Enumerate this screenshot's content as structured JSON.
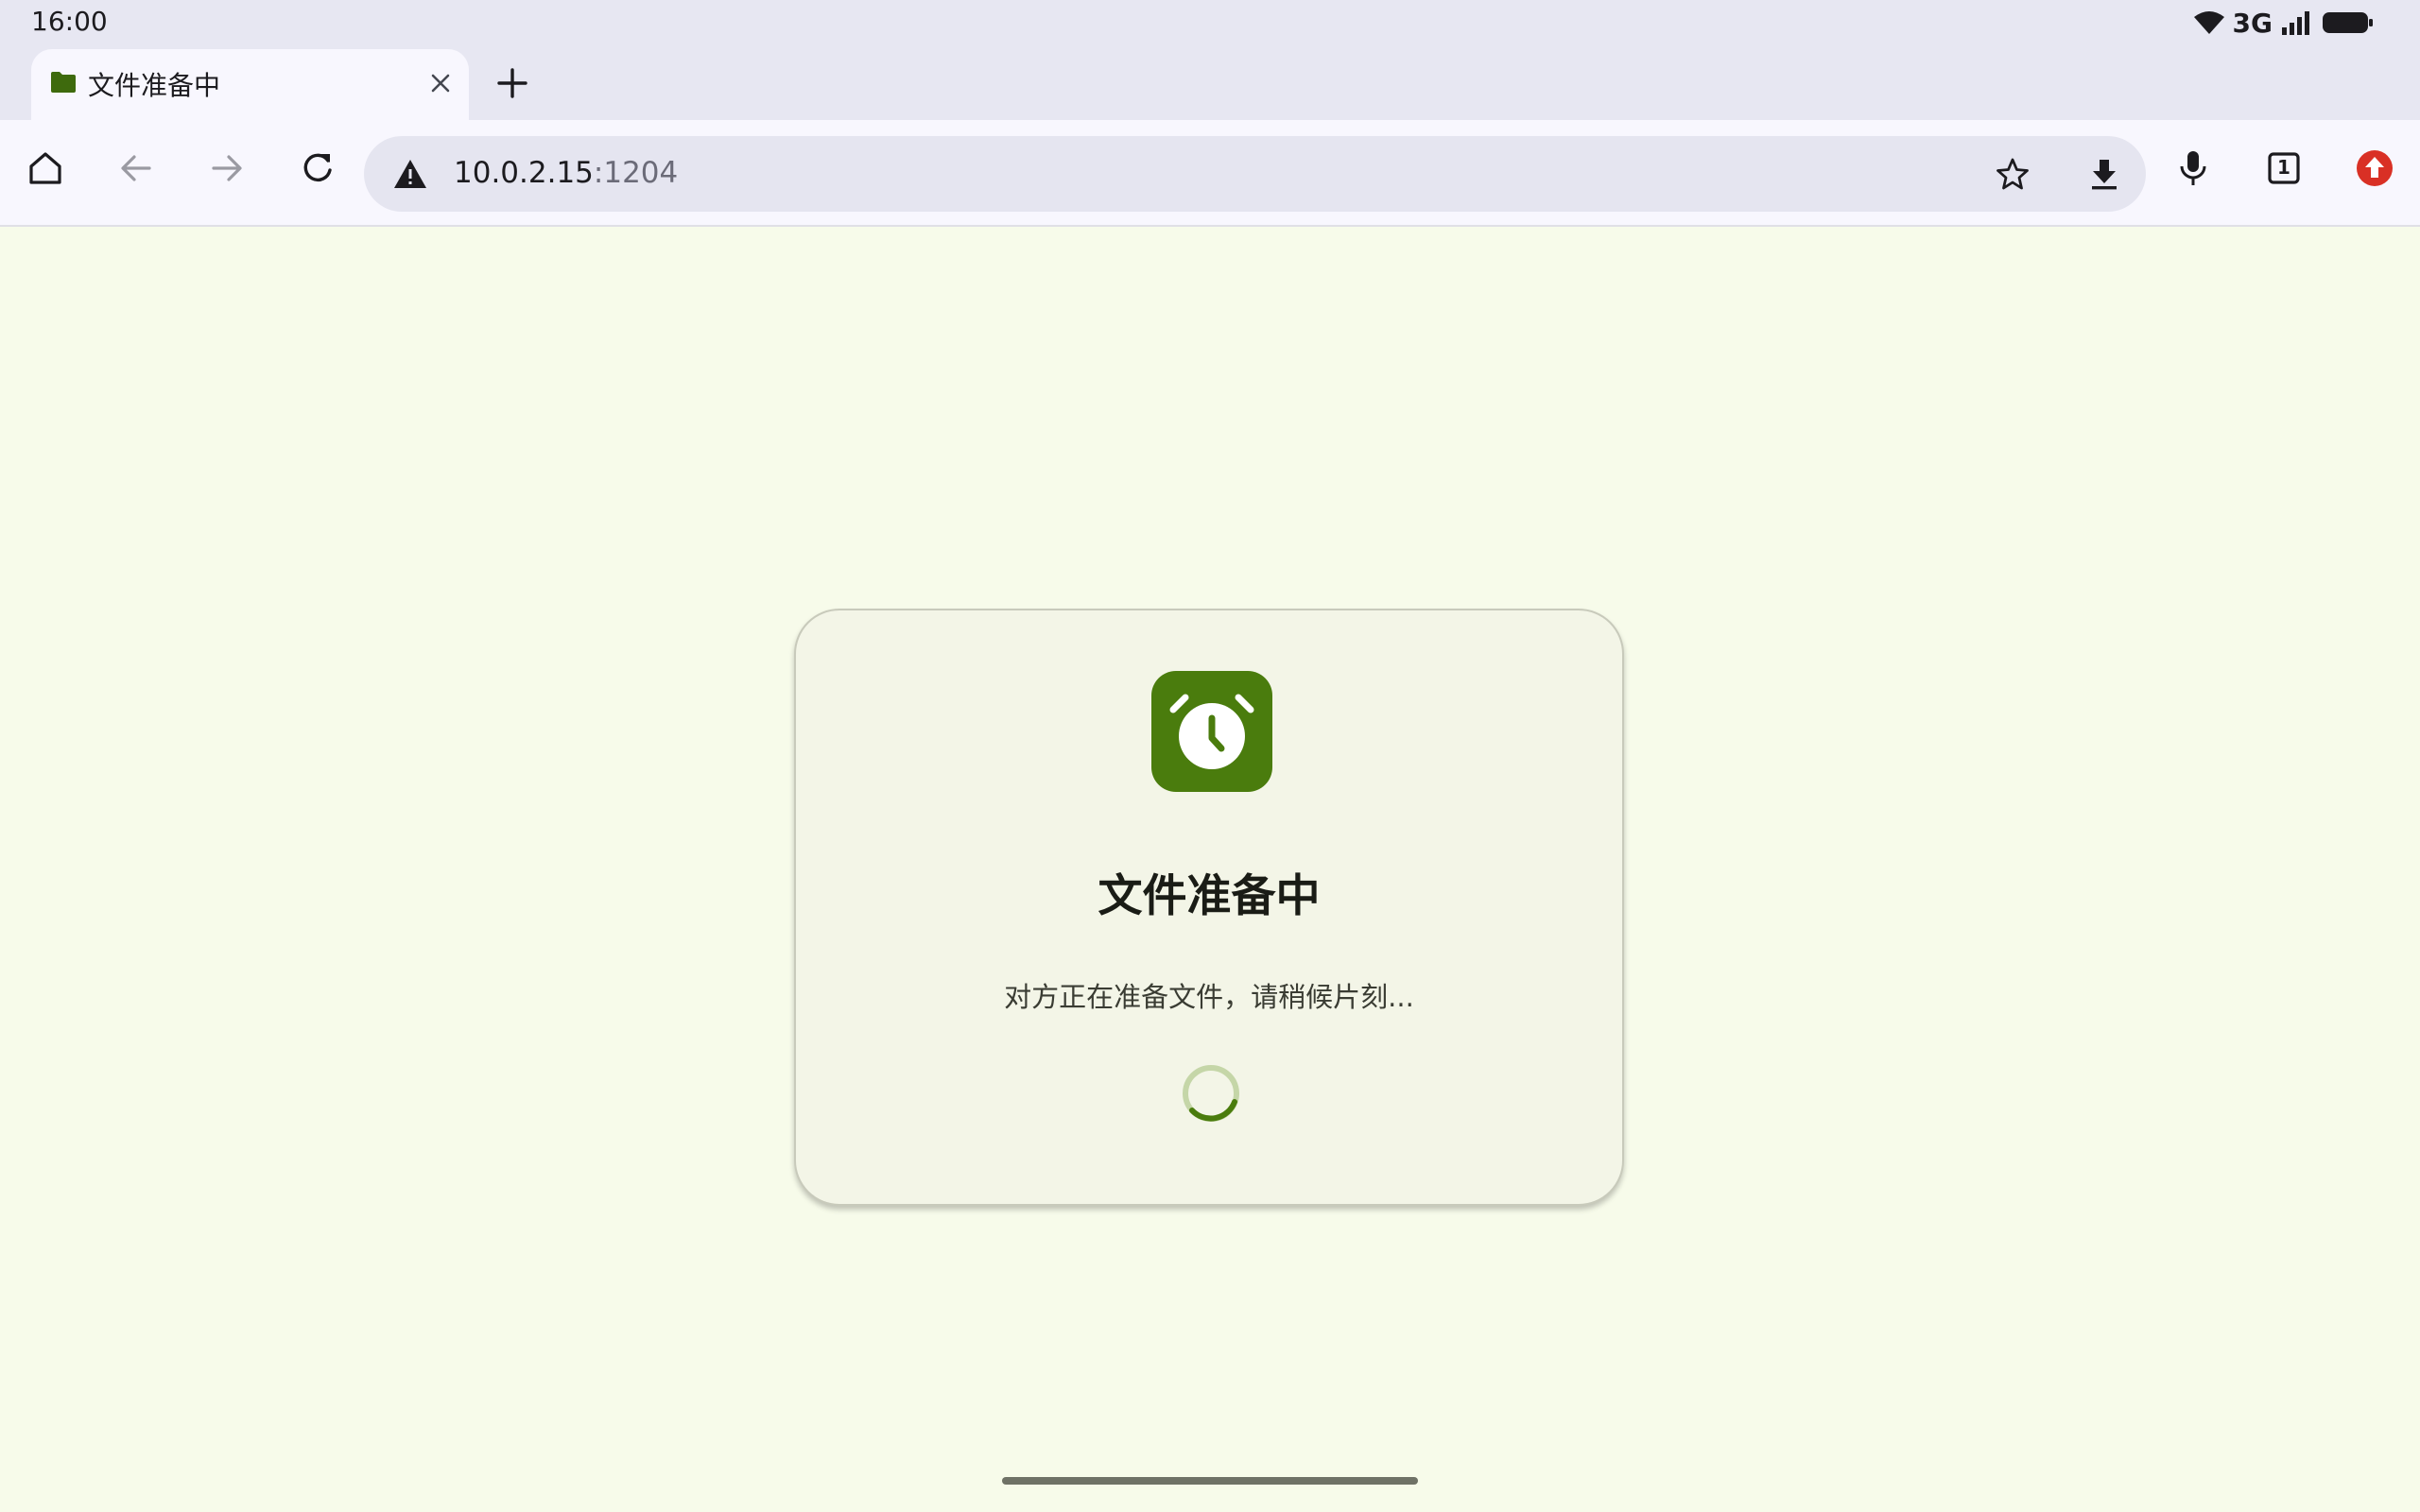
{
  "status_bar": {
    "time": "16:00",
    "network": "3G"
  },
  "tabs": [
    {
      "title": "文件准备中",
      "favicon": "folder-icon"
    }
  ],
  "toolbar": {
    "url_host": "10.0.2.15",
    "url_port": ":1204",
    "tab_count": "1"
  },
  "card": {
    "icon": "alarm-clock-icon",
    "title": "文件准备中",
    "message": "对方正在准备文件，请稍候片刻..."
  },
  "colors": {
    "accent": "#4a7c0d",
    "page_background": "#f7fbea",
    "card_background": "#f3f5e7",
    "browser_chrome": "#e7e7f2",
    "update_badge": "#d93025"
  }
}
